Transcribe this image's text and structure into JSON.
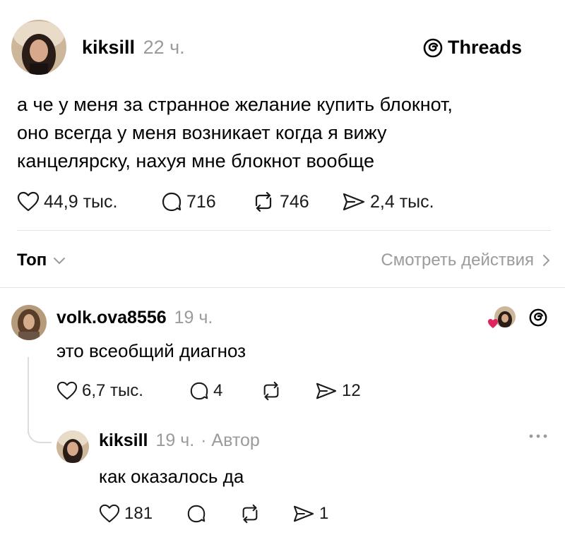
{
  "colors": {
    "text": "#000000",
    "secondary": "#9b9b9b",
    "divider": "#e3e3e3",
    "heart_red": "#e0245e"
  },
  "brand": {
    "icon": "threads-icon",
    "name": "Threads"
  },
  "post": {
    "username": "kiksill",
    "time": "22 ч.",
    "text": "а че у меня за странное желание купить блокнот,\nоно всегда у меня возникает когда я вижу\nканцелярску, нахуя мне блокнот вообще",
    "likes": "44,9 тыс.",
    "comments": "716",
    "reposts": "746",
    "shares": "2,4 тыс."
  },
  "filter": {
    "sort_label": "Топ",
    "activity_label": "Смотреть действия"
  },
  "reply1": {
    "username": "volk.ova8556",
    "time": "19 ч.",
    "text": "это всеобщий диагноз",
    "likes": "6,7 тыс.",
    "comments": "4",
    "reposts": "",
    "shares": "12"
  },
  "reply2": {
    "username": "kiksill",
    "time": "19 ч.",
    "author_tag": "· Автор",
    "text": "как оказалось да",
    "likes": "181",
    "comments": "",
    "reposts": "",
    "shares": "1"
  }
}
